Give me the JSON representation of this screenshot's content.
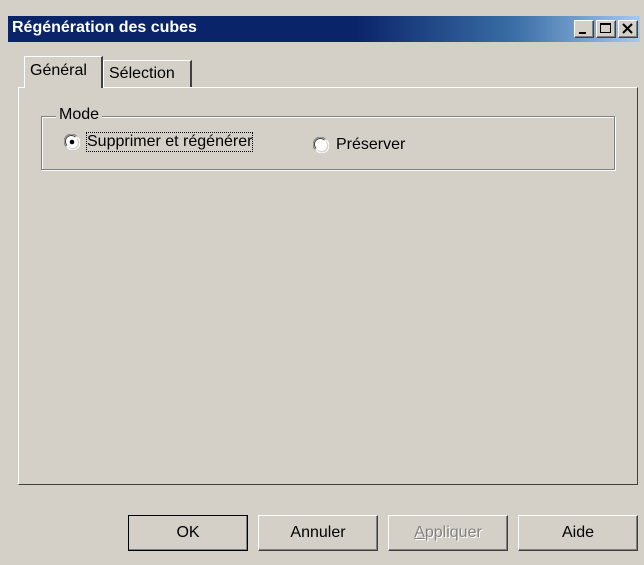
{
  "window": {
    "title": "Régénération des cubes",
    "controls": [
      "minimize-icon",
      "maximize-icon",
      "close-icon"
    ]
  },
  "tabs": [
    {
      "label": "Général",
      "active": true
    },
    {
      "label": "Sélection",
      "active": false
    }
  ],
  "mode_group": {
    "legend": "Mode",
    "options": [
      {
        "label": "Supprimer et régénérer",
        "selected": true
      },
      {
        "label": "Préserver",
        "selected": false
      }
    ]
  },
  "buttons": {
    "ok": "OK",
    "cancel": "Annuler",
    "apply_first": "A",
    "apply_rest": "ppliquer",
    "help": "Aide"
  },
  "colors": {
    "face": "#d4d0c8",
    "title_active": "#0a246a",
    "disabled_text": "#808080"
  }
}
